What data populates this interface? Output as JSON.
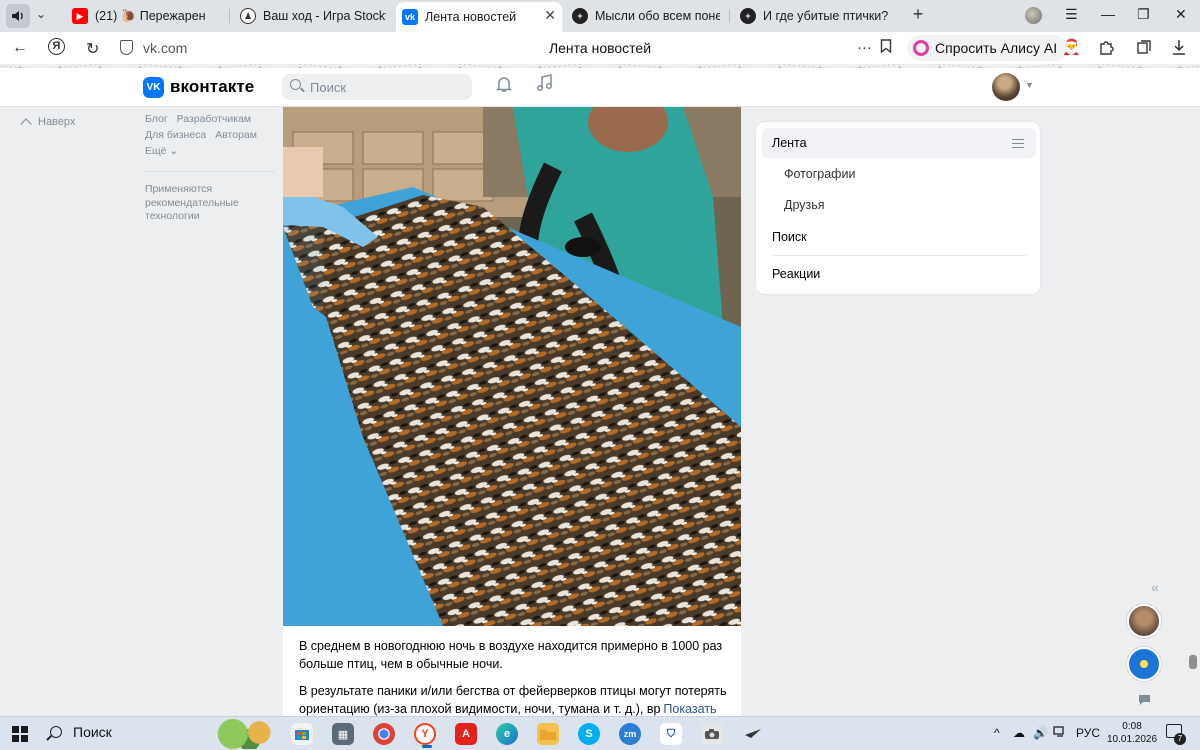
{
  "browser": {
    "tabs": [
      {
        "label": "(21) 🐌 Пережарен",
        "favicon": "youtube-icon",
        "color": "#ff0000"
      },
      {
        "label": "Ваш ход - Игра Stockfish I",
        "favicon": "chess-icon",
        "color": "#333333"
      },
      {
        "label": "Лента новостей",
        "favicon": "vk-icon",
        "color": "#0077ff",
        "active": true
      },
      {
        "label": "Мысли обо всем понемн",
        "favicon": "plus-circle-icon",
        "color": "#222222"
      },
      {
        "label": "И где убитые птички?! | М",
        "favicon": "plus-circle-icon",
        "color": "#222222"
      }
    ],
    "url": "vk.com",
    "page_title": "Лента новостей",
    "alice_label": "Спросить Алису AI"
  },
  "vk": {
    "brand": "вконтакте",
    "logo_text": "VK",
    "search_placeholder": "Поиск",
    "to_top": "Наверх",
    "footer_links": [
      "Блог",
      "Разработчикам",
      "Для бизнеса",
      "Авторам",
      "Ещё ⌄"
    ],
    "recommendation_note": "Применяются рекомендательные технологии",
    "post": {
      "paragraph1": "В среднем в новогоднюю ночь в воздухе находится примерно в 1000 раз больше птиц, чем в обычные ночи.",
      "paragraph2_visible": "В результате паники и/или бегства от фейерверков птицы могут потерять ориентацию (из-за плохой видимости, ночи, тумана и т. д.), вр",
      "show_more": "Показать ещё"
    },
    "right_menu": {
      "items": [
        {
          "label": "Лента"
        },
        {
          "label": "Фотографии"
        },
        {
          "label": "Друзья"
        },
        {
          "label": "Поиск"
        },
        {
          "label": "Реакции"
        }
      ]
    }
  },
  "taskbar": {
    "search_label": "Поиск",
    "language": "РУС",
    "time": "0:08",
    "date": "10.01.2026",
    "notifications": "7"
  }
}
